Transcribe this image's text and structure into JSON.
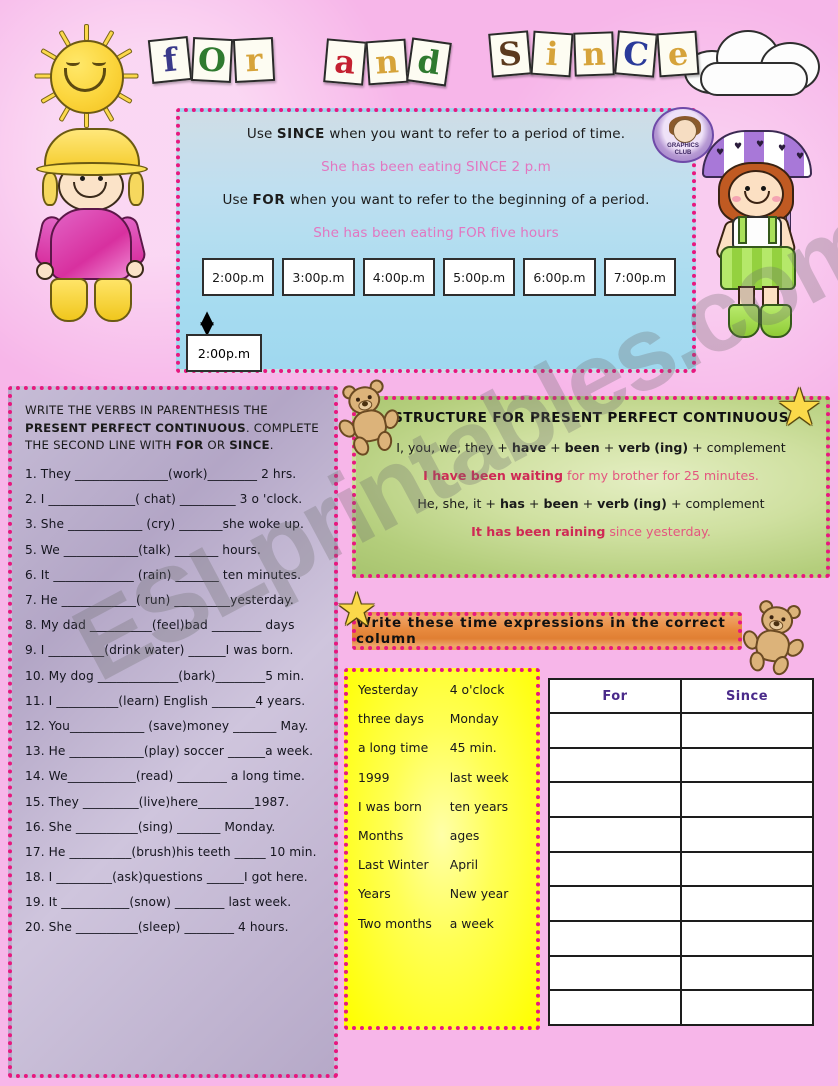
{
  "title": {
    "words": [
      {
        "name": "for",
        "letters": [
          {
            "ch": "f",
            "color": "#3a3a8a"
          },
          {
            "ch": "O",
            "color": "#2f7a2f"
          },
          {
            "ch": "r",
            "color": "#d6a33a"
          }
        ]
      },
      {
        "name": "and",
        "letters": [
          {
            "ch": "a",
            "color": "#c42030"
          },
          {
            "ch": "n",
            "color": "#d6a33a"
          },
          {
            "ch": "d",
            "color": "#2f7a2f"
          }
        ]
      },
      {
        "name": "since",
        "letters": [
          {
            "ch": "S",
            "color": "#5b3a1e"
          },
          {
            "ch": "i",
            "color": "#d6a33a"
          },
          {
            "ch": "n",
            "color": "#d6a33a"
          },
          {
            "ch": "C",
            "color": "#2a3a9a"
          },
          {
            "ch": "e",
            "color": "#d6a33a"
          }
        ]
      }
    ]
  },
  "watermark": "ESLprintables.com",
  "stamp": {
    "line1": "GRAPHICS",
    "line2": "CLUB"
  },
  "info_box": {
    "line1_pre": "Use ",
    "line1_bold": "SINCE",
    "line1_post": " when you want to refer to a period of time.",
    "example1": "She has been eating SINCE 2 p.m",
    "line2_pre": "Use ",
    "line2_bold": "FOR",
    "line2_post": " when you want to refer to the beginning of a period.",
    "example2": "She has been eating FOR five hours",
    "times": [
      "2:00p.m",
      "3:00p.m",
      "4:00p.m",
      "5:00p.m",
      "6:00p.m",
      "7:00p.m"
    ],
    "time_below": "2:00p.m"
  },
  "exercise": {
    "heading_line1": "WRITE THE VERBS IN PARENTHESIS THE",
    "heading_bold1": "PRESENT  PERFECT CONTINUOUS",
    "heading_mid": ". COMPLETE",
    "heading_line2_pre": "THE SECOND LINE WITH ",
    "heading_bold2": "FOR",
    "heading_or": " OR ",
    "heading_bold3": "SINCE",
    "heading_end": ".",
    "items": [
      "1. They _______________(work)________ 2 hrs.",
      "2. I ______________( chat) _________ 3 o 'clock.",
      "3. She ____________ (cry) _______she woke up.",
      "5. We ____________(talk) _______ hours.",
      "6. It _____________ (rain) _______ ten minutes.",
      "7. He ____________( run) _________yesterday.",
      "8. My dad __________(feel)bad ________ days",
      "9. I _________(drink water) ______I was born.",
      "10. My dog _____________(bark)________5 min.",
      "11. I __________(learn) English _______4 years.",
      "12. You____________ (save)money _______ May.",
      "13. He ____________(play) soccer ______a week.",
      "14. We___________(read) ________ a long time.",
      "15. They _________(live)here_________1987.",
      "16. She __________(sing) _______ Monday.",
      "17. He __________(brush)his teeth _____ 10 min.",
      "18. I _________(ask)questions ______I got here.",
      "19. It ___________(snow) ________ last week.",
      "20. She __________(sleep) ________ 4 hours."
    ]
  },
  "structure": {
    "title": "STRUCTURE FOR PRESENT PERFECT CONTINUOUS",
    "line1": {
      "pre": "I, you, we, they + ",
      "b1": "have",
      "mid1": " + ",
      "b2": "been",
      "mid2": " + ",
      "b3": "verb",
      "b4": "(ing)",
      "post": " + complement"
    },
    "example1": {
      "bold": "I have been waiting",
      "rest": " for my brother for 25 minutes."
    },
    "line2": {
      "pre": "He, she, it + ",
      "b1": "has",
      "mid1": " + ",
      "b2": "been",
      "mid2": " + ",
      "b3": "verb",
      "b4": "(ing)",
      "post": " + complement"
    },
    "example2": {
      "bold": "It has been raining",
      "rest": " since yesterday."
    }
  },
  "banner": {
    "text": "Write these time expressions in the correct column"
  },
  "word_box": {
    "rows": [
      {
        "a": "Yesterday",
        "b": "4 o'clock"
      },
      {
        "a": "three days",
        "b": "Monday"
      },
      {
        "a": "a long time",
        "b": "45 min."
      },
      {
        "a": "1999",
        "b": "last week"
      },
      {
        "a": "I was born",
        "b": "ten years"
      },
      {
        "a": "Months",
        "b": "ages"
      },
      {
        "a": "Last Winter",
        "b": "April"
      },
      {
        "a": "Years",
        "b": "New year"
      },
      {
        "a": "Two months",
        "b": "a week"
      }
    ]
  },
  "fs_table": {
    "headers": [
      "For",
      "Since"
    ],
    "empty_rows": 9
  },
  "colors": {
    "background_pink": "#f7b6e9",
    "dotted_border": "#e8177f",
    "info_blue": "#a8dcf0",
    "panel_lavender": "#b3a6c6",
    "structure_green": "#cfe0a0",
    "banner_orange": "#e88a3e",
    "word_box_yellow": "#ffff00",
    "header_purple": "#4a2a8a",
    "pink_text": "#e276c0",
    "red_text": "#cf2a55"
  }
}
